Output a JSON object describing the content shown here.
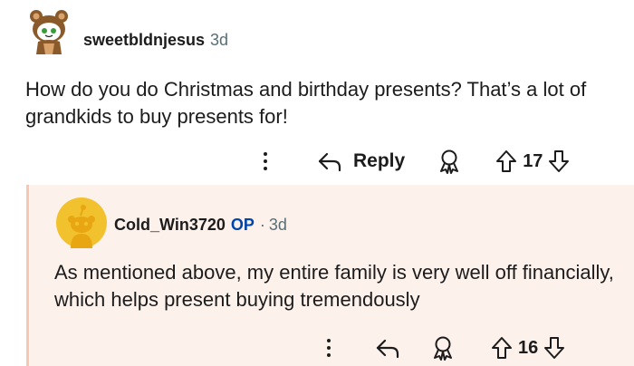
{
  "top_comment": {
    "username": "sweetbldnjesus",
    "age": "3d",
    "body": "How do you do Christmas and birthday presents? That’s a lot of grandkids to buy presents for!",
    "reply_label": "Reply",
    "vote_count": "17",
    "icons": [
      "more-vertical-icon",
      "reply-arrow-icon",
      "award-icon",
      "upvote-arrow-icon",
      "downvote-arrow-icon"
    ]
  },
  "reply_comment": {
    "username": "Cold_Win3720",
    "op_badge": "OP",
    "separator": "·",
    "age": "3d",
    "body": "As mentioned above, my entire family is very well off financially, which helps present buying tremendously",
    "vote_count": "16",
    "icons": [
      "more-vertical-icon",
      "reply-arrow-icon",
      "award-icon",
      "upvote-arrow-icon",
      "downvote-arrow-icon"
    ]
  },
  "colors": {
    "reply_background": "#fdf1ec",
    "thread_line": "#f7c7b3",
    "op_badge": "#0045ac",
    "meta_gray": "#576f76",
    "avatar_yellow": "#f2c12e"
  }
}
